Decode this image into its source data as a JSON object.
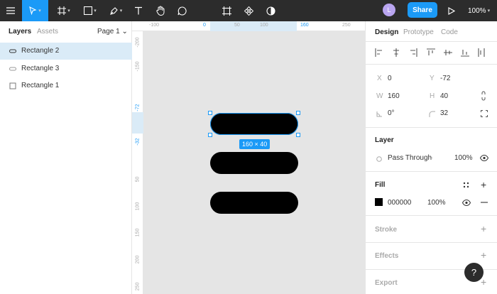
{
  "toolbar": {
    "share_label": "Share",
    "zoom": "100%",
    "avatar_initial": "L",
    "caret": "▾"
  },
  "left": {
    "tabs": [
      "Layers",
      "Assets"
    ],
    "page_selector": "Page 1 ⌄",
    "layers": [
      {
        "name": "Rectangle 2",
        "icon": "pill-shape-icon"
      },
      {
        "name": "Rectangle 3",
        "icon": "pill-shape-icon"
      },
      {
        "name": "Rectangle 1",
        "icon": "rectangle-icon"
      }
    ]
  },
  "rulers": {
    "top": [
      {
        "label": "-100",
        "sel": false
      },
      {
        "label": "0",
        "sel": true
      },
      {
        "label": "50",
        "sel": false
      },
      {
        "label": "100",
        "sel": false
      },
      {
        "label": "160",
        "sel": true
      },
      {
        "label": "250",
        "sel": false
      }
    ],
    "left": [
      {
        "label": "-200",
        "sel": false
      },
      {
        "label": "-150",
        "sel": false
      },
      {
        "label": "-72",
        "sel": true
      },
      {
        "label": "-32",
        "sel": true
      },
      {
        "label": "50",
        "sel": false
      },
      {
        "label": "100",
        "sel": false
      },
      {
        "label": "150",
        "sel": false
      },
      {
        "label": "200",
        "sel": false
      },
      {
        "label": "250",
        "sel": false
      }
    ]
  },
  "canvas": {
    "dimensions_badge": "160 × 40",
    "fill_color": "#000000",
    "selection_color": "#1b9af7"
  },
  "right": {
    "tabs": [
      "Design",
      "Prototype",
      "Code"
    ],
    "x_label": "X",
    "x_value": "0",
    "y_label": "Y",
    "y_value": "-72",
    "w_label": "W",
    "w_value": "160",
    "h_label": "H",
    "h_value": "40",
    "rotation_value": "0°",
    "radius_value": "32",
    "layer_title": "Layer",
    "blend_mode": "Pass Through",
    "blend_caret": "⌄",
    "layer_opacity": "100%",
    "fill_title": "Fill",
    "fill_hex": "000000",
    "fill_opacity": "100%",
    "stroke_title": "Stroke",
    "effects_title": "Effects",
    "export_title": "Export",
    "plus": "+",
    "help": "?"
  }
}
